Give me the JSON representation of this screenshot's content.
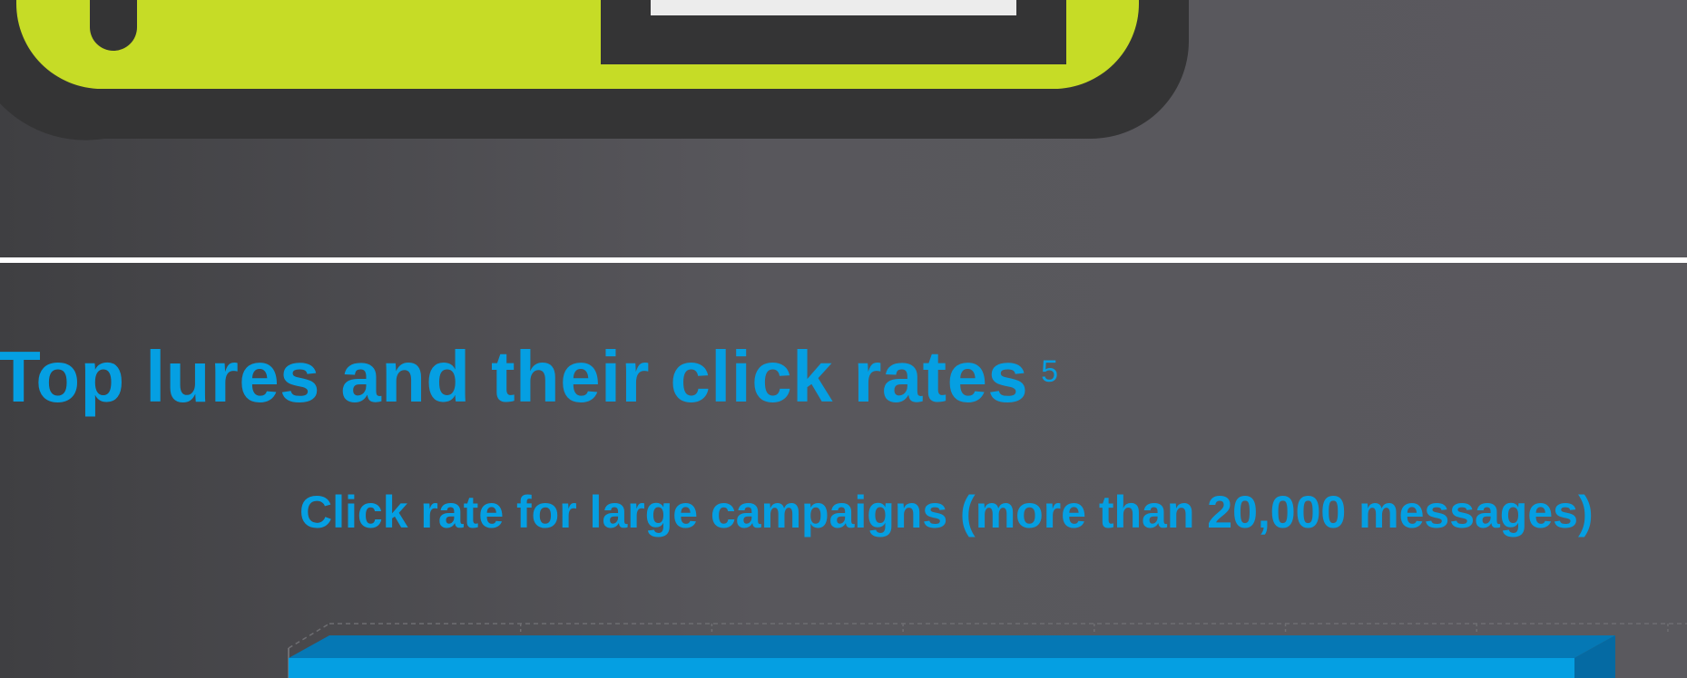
{
  "section": {
    "title": "Top lures and their click rates",
    "footnote_marker": "5"
  },
  "colors": {
    "accent": "#059fe2",
    "lime": "#c6dc26",
    "dark_outline": "#343435",
    "light_panel": "#ececec",
    "divider": "#ffffff"
  },
  "chart_data": {
    "type": "bar",
    "title": "Click rate for large campaigns (more than 20,000 messages)",
    "orientation": "horizontal",
    "three_d": true,
    "grid": true,
    "bars": [
      {
        "value": 0.92,
        "color": "#059fe2"
      }
    ],
    "xlim": [
      0,
      1
    ]
  }
}
